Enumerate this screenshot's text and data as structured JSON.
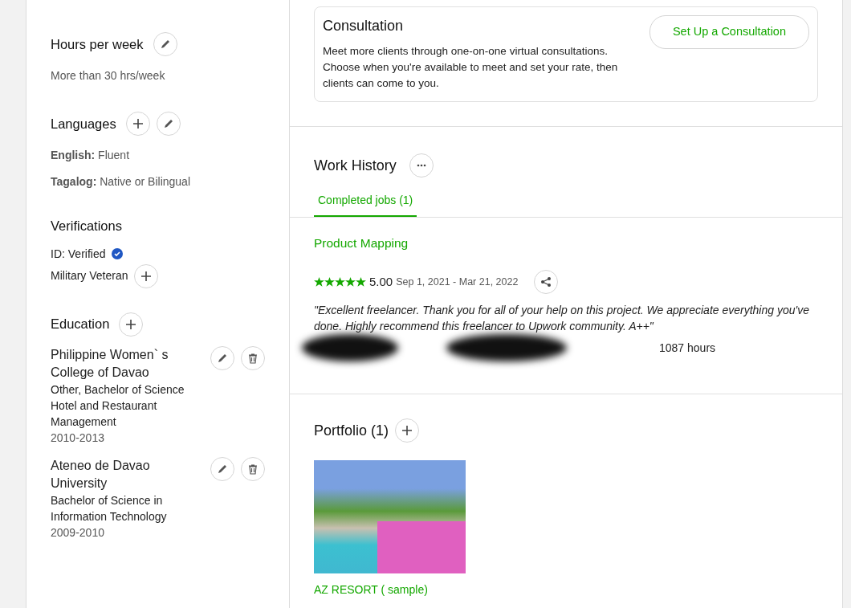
{
  "sidebar": {
    "sections": [
      {
        "kind": "text",
        "title": "Hours per week",
        "can_add": false,
        "can_edit": true,
        "lines": [
          "More than 30 hrs/week"
        ]
      },
      {
        "kind": "text",
        "title": "Languages",
        "can_add": true,
        "can_edit": true,
        "lines": [
          "**English:** Fluent",
          "**Tagalog:** Native or Bilingual"
        ]
      },
      {
        "kind": "verifications",
        "title": "Verifications",
        "items": [
          {
            "label": "ID: Verified",
            "verified": true
          },
          {
            "label": "Military Veteran",
            "verified": false
          }
        ]
      },
      {
        "kind": "education",
        "title": "Education",
        "can_add": true,
        "can_edit": false,
        "items": [
          {
            "school": "Philippine Women` s College of Davao",
            "degree": "Other, Bachelor of Science Hotel and Restaurant Management",
            "years": "2010-2013"
          },
          {
            "school": "Ateneo de Davao University",
            "degree": "Bachelor of Science in Information Technology",
            "years": "2009-2010"
          }
        ]
      }
    ]
  },
  "consultation": {
    "title": "Consultation",
    "text": "Meet more clients through one-on-one virtual consultations. Choose when you're available to meet and set your rate, then clients can come to you.",
    "button": "Set Up a Consultation"
  },
  "work_history": {
    "title": "Work History",
    "tabs": [
      {
        "label": "Completed jobs (1)",
        "selected": true
      }
    ],
    "jobs": [
      {
        "title": "Product Mapping",
        "stars": 5,
        "rating": "5.00",
        "dates": "Sep 1, 2021 - Mar 21, 2022",
        "review": "\"Excellent freelancer. Thank you for all of your help on this project. We appreciate everything you've done. Highly recommend this freelancer to Upwork community. A++\"",
        "hours": "1087 hours"
      }
    ]
  },
  "portfolio": {
    "title": "Portfolio (1)",
    "items": [
      {
        "title": "AZ RESORT ( sample)"
      }
    ]
  }
}
